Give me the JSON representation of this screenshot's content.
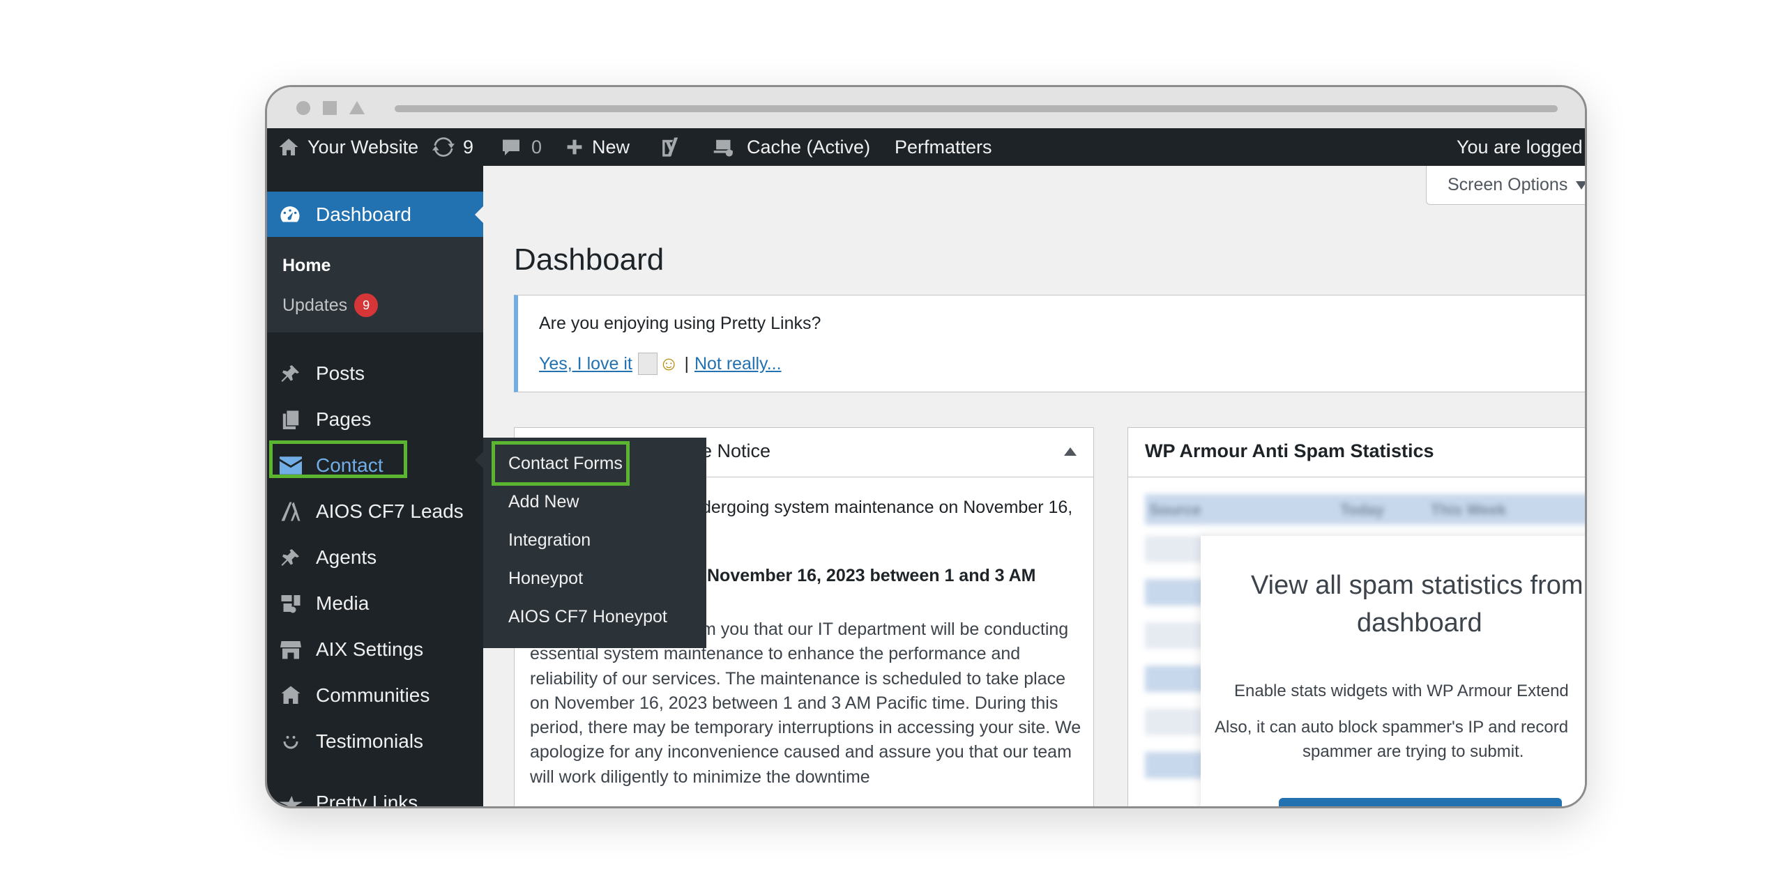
{
  "admin_bar": {
    "site_name": "Your Website",
    "updates_count": "9",
    "comments_count": "0",
    "new_label": "New",
    "cache_label": "Cache (Active)",
    "perfmatters_label": "Perfmatters",
    "logged_in_text": "You are logged in"
  },
  "sidebar": {
    "dashboard_label": "Dashboard",
    "home_label": "Home",
    "updates_label": "Updates",
    "updates_badge": "9",
    "items": [
      {
        "label": "Posts",
        "icon": "pin-icon"
      },
      {
        "label": "Pages",
        "icon": "pages-icon"
      },
      {
        "label": "Contact",
        "icon": "envelope-icon"
      },
      {
        "label": "AIOS CF7 Leads",
        "icon": "aios-icon"
      },
      {
        "label": "Agents",
        "icon": "pin-icon"
      },
      {
        "label": "Media",
        "icon": "media-icon"
      },
      {
        "label": "AIX Settings",
        "icon": "store-icon"
      },
      {
        "label": "Communities",
        "icon": "houses-icon"
      },
      {
        "label": "Testimonials",
        "icon": "smiley-icon"
      },
      {
        "label": "Pretty Links",
        "icon": "star-icon"
      }
    ]
  },
  "flyout": {
    "items": [
      "Contact Forms",
      "Add New",
      "Integration",
      "Honeypot",
      "AIOS CF7 Honeypot"
    ]
  },
  "main": {
    "screen_options": "Screen Options",
    "page_title": "Dashboard",
    "notice": {
      "question": "Are you enjoying using Pretty Links?",
      "yes_link": "Yes, I love it",
      "separator": "|",
      "no_link": "Not really..."
    },
    "maintenance_box": {
      "title_fragment": "e Notice",
      "line1": "dergoing system maintenance on November 16,",
      "strong": "November 16, 2023 between 1 and 3 AM",
      "para_start": "m you that our IT department will be conducting",
      "para_rest": "essential system maintenance to enhance the performance and reliability of our services. The maintenance is scheduled to take place on November 16, 2023 between 1 and 3 AM Pacific time. During this period, there may be temporary interruptions in accessing your site. We apologize for any inconvenience caused and assure you that our team will work diligently to minimize the downtime"
    },
    "armour_box": {
      "title": "WP Armour Anti Spam Statistics",
      "blurred_headers": [
        "Source",
        "Today",
        "This Week"
      ],
      "promo_title_line1": "View all spam statistics from",
      "promo_title_line2": "dashboard",
      "promo_p1": "Enable stats widgets with WP Armour Extend",
      "promo_p2": "Also, it can auto block spammer's IP and record",
      "promo_p3": "spammer are trying to submit."
    }
  },
  "colors": {
    "admin_dark": "#1d2327",
    "submenu_dark": "#2c3338",
    "wp_blue": "#2271b1",
    "link_blue": "#72aee6",
    "highlight_green": "#5bb530",
    "badge_red": "#d63638"
  }
}
